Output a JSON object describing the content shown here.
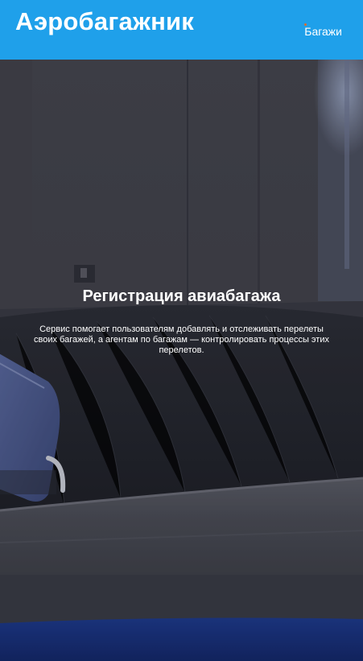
{
  "header": {
    "logo": "Аэробагажник",
    "nav": [
      {
        "label": "Багажи"
      }
    ]
  },
  "hero": {
    "title": "Регистрация авиабагажа",
    "description": "Сервис помогает пользователям добавлять и отслеживать перелеты своих багажей, а агентам по багажам — контролировать процессы этих перелетов."
  },
  "colors": {
    "header_bg": "#1fa0ea",
    "text": "#ffffff",
    "nav_dot": "#e46a2a"
  }
}
